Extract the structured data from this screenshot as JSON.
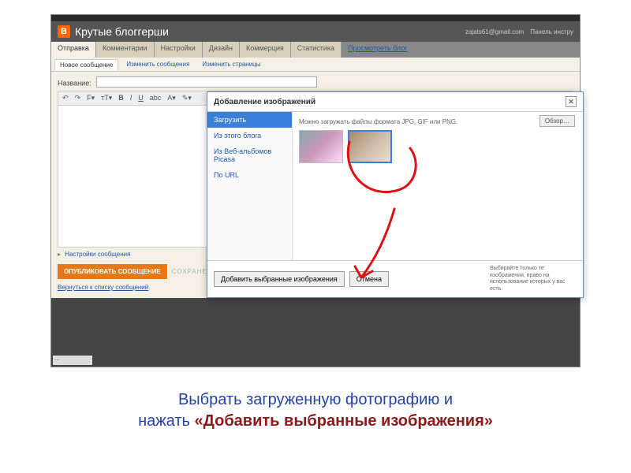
{
  "header": {
    "title": "Крутые блоггерши",
    "email": "zajats61@gmail.com",
    "panel_link": "Панель инстру"
  },
  "tabs": {
    "items": [
      "Отправка",
      "Комментарии",
      "Настройки",
      "Дизайн",
      "Коммерция",
      "Статистика"
    ],
    "preview": "Просмотреть блог"
  },
  "subtabs": {
    "items": [
      "Новое сообщение",
      "Изменить сообщения",
      "Изменить страницы"
    ]
  },
  "editor": {
    "name_label": "Название:",
    "settings_link": "Настройки сообщения",
    "publish": "ОПУБЛИКОВАТЬ СООБЩЕНИЕ",
    "saved": "СОХРАНЕНО",
    "back": "Вернуться к списку сообщений"
  },
  "modal": {
    "title": "Добавление изображений",
    "sidebar": [
      "Загрузить",
      "Из этого блога",
      "Из Веб-альбомов Picasa",
      "По URL"
    ],
    "hint": "Можно загружать файлы формата JPG, GIF или PNG.",
    "browse": "Обзор…",
    "add": "Добавить выбранные изображения",
    "cancel": "Отмена",
    "foot_hint": "Выбирайте только те изображения, право на использование которых у вас есть."
  },
  "caption": {
    "line1": "Выбрать загруженную фотографию и",
    "line2_pre": "нажать ",
    "line2_bold": "«Добавить выбранные изображения»"
  }
}
